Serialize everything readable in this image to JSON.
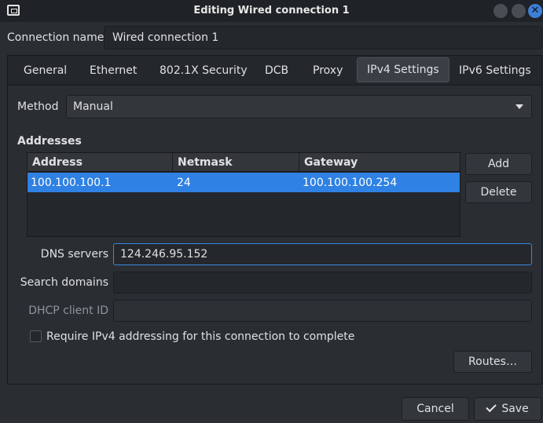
{
  "window": {
    "title": "Editing Wired connection 1",
    "app_icon": "window-icon",
    "controls": [
      "minimize",
      "maximize",
      "close"
    ]
  },
  "connection_name": {
    "label": "Connection name",
    "value": "Wired connection 1"
  },
  "tabs": [
    {
      "label": "General"
    },
    {
      "label": "Ethernet"
    },
    {
      "label": "802.1X Security"
    },
    {
      "label": "DCB"
    },
    {
      "label": "Proxy"
    },
    {
      "label": "IPv4 Settings",
      "active": true
    },
    {
      "label": "IPv6 Settings"
    }
  ],
  "method": {
    "label": "Method",
    "value": "Manual"
  },
  "addresses": {
    "title": "Addresses",
    "columns": [
      "Address",
      "Netmask",
      "Gateway"
    ],
    "rows": [
      {
        "address": "100.100.100.1",
        "netmask": "24",
        "gateway": "100.100.100.254"
      }
    ],
    "add_label": "Add",
    "delete_label": "Delete"
  },
  "dns": {
    "label": "DNS servers",
    "value": "124.246.95.152"
  },
  "search_domains": {
    "label": "Search domains",
    "value": ""
  },
  "dhcp_client_id": {
    "label": "DHCP client ID",
    "value": ""
  },
  "require_ipv4": {
    "label": "Require IPv4 addressing for this connection to complete",
    "checked": false
  },
  "routes_label": "Routes…",
  "footer": {
    "cancel_label": "Cancel",
    "save_label": "Save"
  },
  "colors": {
    "accent": "#2f81e3",
    "background": "#2a2e33",
    "close_button": "#3c7fd6"
  }
}
